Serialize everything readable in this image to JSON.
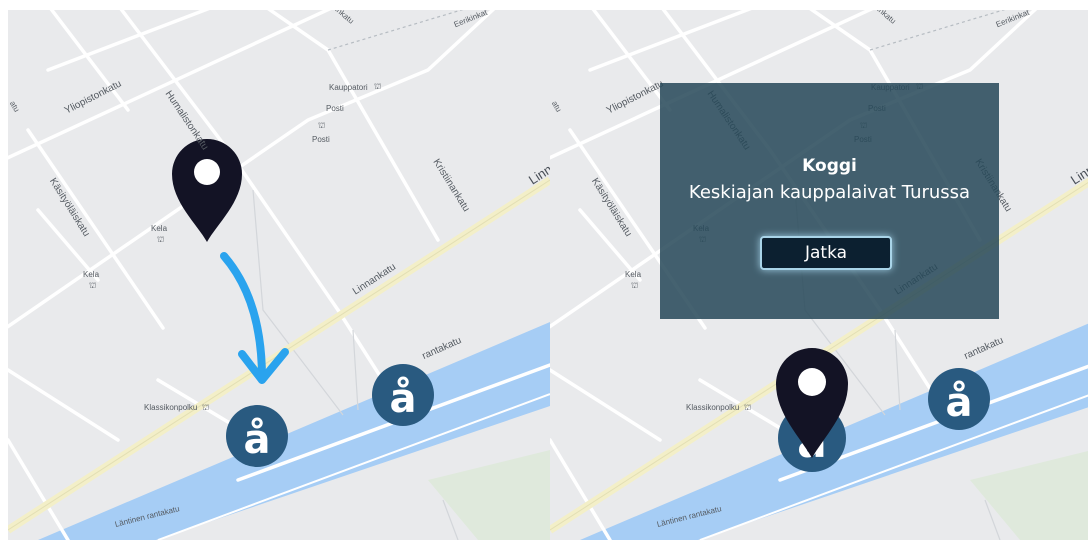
{
  "map": {
    "streets": {
      "yliopistonkatu": "Yliopistonkatu",
      "humalistonkatu": "Humalistonkatu",
      "kasityolaiskatu": "Käsityöläiskatu",
      "kristiinankatu": "Kristiinankatu",
      "linnankatu": "Linnankatu",
      "linnankatu_edge": "Linn",
      "eerikinkatu": "Eerikinkat",
      "aninkaistenkatu": "aninkatu",
      "rantakatu": "rantakatu",
      "lantinen_rantakatu": "Läntinen rantakatu",
      "katu_edge": "atu"
    },
    "pois": {
      "kauppatori": "Kauppatori",
      "posti_1": "Posti",
      "posti_2": "Posti",
      "kela_1": "Kela",
      "kela_2": "Kela",
      "klassikonpolku": "Klassikonpolku"
    },
    "markers": {
      "logo_glyph": "å",
      "poi_glyph": "⛫"
    },
    "colors": {
      "land": "#e9eaec",
      "road": "#ffffff",
      "main_road": "#f3efc8",
      "water": "#a6cdf5",
      "park": "#dfe9dc",
      "pin": "#131325",
      "arrow": "#2aa3ee",
      "marker": "#295a80",
      "overlay": "#264858"
    }
  },
  "dialog": {
    "title": "Koggi",
    "subtitle": "Keskiajan kauppalaivat Turussa",
    "continue_label": "Jatka"
  }
}
